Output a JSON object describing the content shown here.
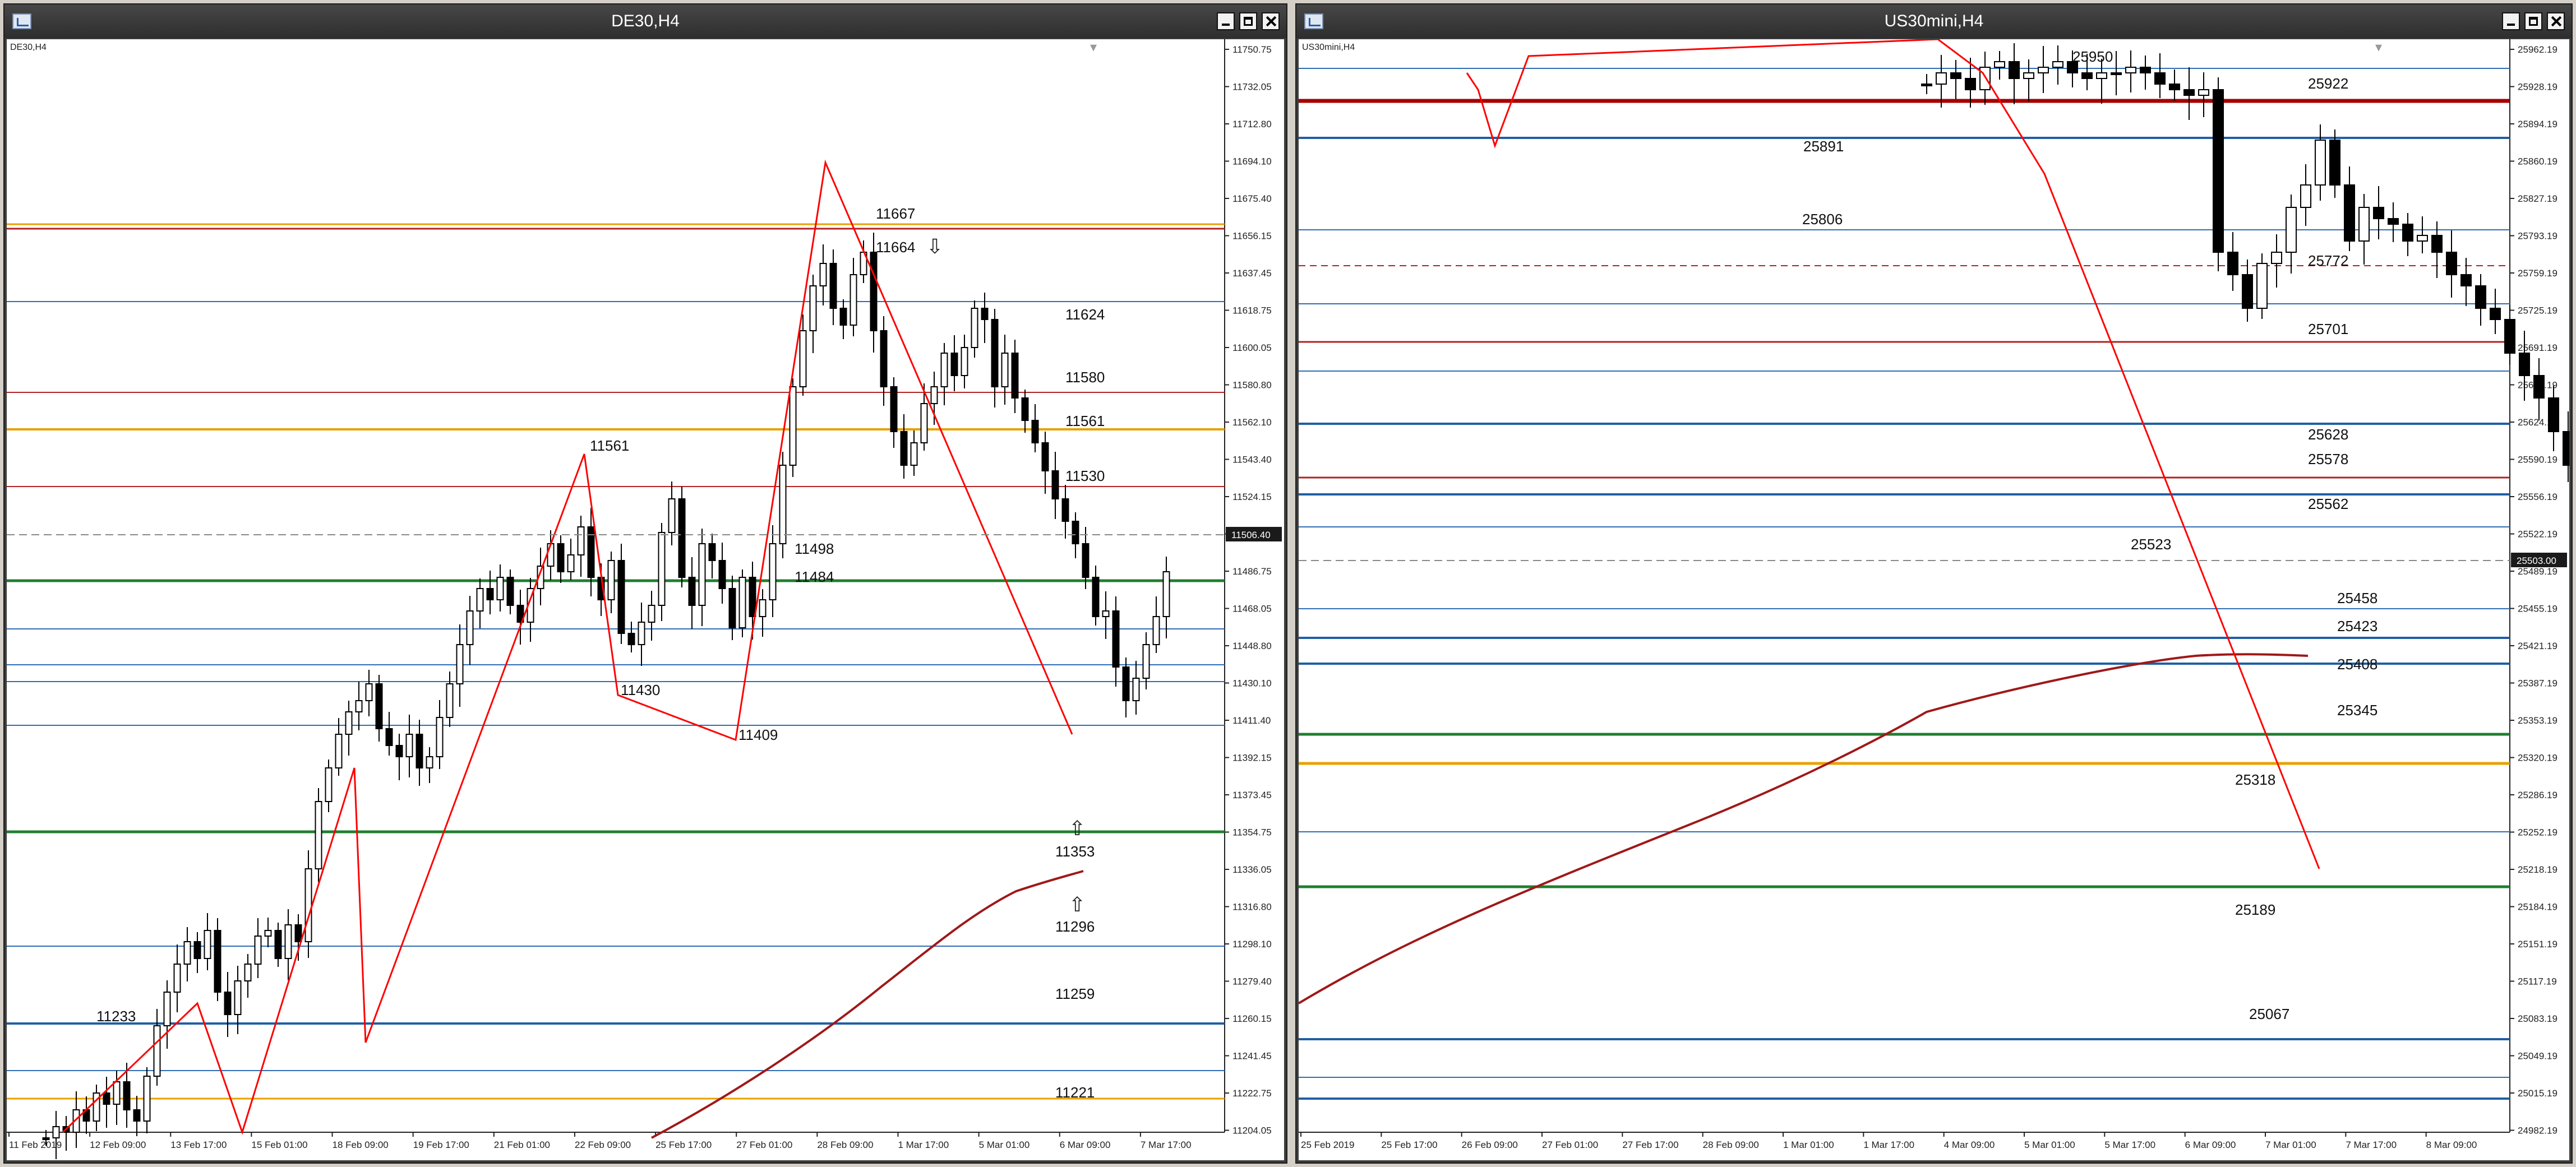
{
  "windows": [
    {
      "id": "left",
      "title": "DE30,H4",
      "symbol_label": "DE30,H4",
      "price_axis": [
        "11750.75",
        "11732.05",
        "11712.80",
        "11694.10",
        "11675.40",
        "11656.15",
        "11637.45",
        "11618.75",
        "11600.05",
        "11580.80",
        "11562.10",
        "11543.40",
        "11524.15",
        "11505.45",
        "11486.75",
        "11468.05",
        "11448.80",
        "11430.10",
        "11411.40",
        "11392.15",
        "11373.45",
        "11354.75",
        "11336.05",
        "11316.80",
        "11298.10",
        "11279.40",
        "11260.15",
        "11241.45",
        "11222.75",
        "11204.05"
      ],
      "current_price": "11506.40",
      "time_axis": [
        "11 Feb 2019",
        "12 Feb 09:00",
        "13 Feb 17:00",
        "15 Feb 01:00",
        "18 Feb 09:00",
        "19 Feb 17:00",
        "21 Feb 01:00",
        "22 Feb 09:00",
        "25 Feb 17:00",
        "27 Feb 01:00",
        "28 Feb 09:00",
        "1 Mar 17:00",
        "5 Mar 01:00",
        "6 Mar 09:00",
        "7 Mar 17:00"
      ],
      "level_labels": [
        "11667",
        "11664",
        "11624",
        "11580",
        "11561",
        "11530",
        "11498",
        "11484",
        "11430",
        "11409",
        "11353",
        "11296",
        "11259",
        "11233",
        "11221",
        "11561"
      ]
    },
    {
      "id": "right",
      "title": "US30mini,H4",
      "symbol_label": "US30mini,H4",
      "price_axis": [
        "25962.19",
        "25928.19",
        "25894.19",
        "25860.19",
        "25827.19",
        "25793.19",
        "25759.19",
        "25725.19",
        "25691.19",
        "25658.19",
        "25624.19",
        "25590.19",
        "25556.19",
        "25522.19",
        "25489.19",
        "25455.19",
        "25421.19",
        "25387.19",
        "25353.19",
        "25320.19",
        "25286.19",
        "25252.19",
        "25218.19",
        "25184.19",
        "25151.19",
        "25117.19",
        "25083.19",
        "25049.19",
        "25015.19",
        "24982.19"
      ],
      "current_price": "25503.00",
      "time_axis": [
        "25 Feb 2019",
        "25 Feb 17:00",
        "26 Feb 09:00",
        "27 Feb 01:00",
        "27 Feb 17:00",
        "28 Feb 09:00",
        "1 Mar 01:00",
        "1 Mar 17:00",
        "4 Mar 09:00",
        "5 Mar 01:00",
        "5 Mar 17:00",
        "6 Mar 09:00",
        "7 Mar 01:00",
        "7 Mar 17:00",
        "8 Mar 09:00"
      ],
      "level_labels": [
        "25950",
        "25922",
        "25891",
        "25806",
        "25772",
        "25701",
        "25628",
        "25578",
        "25562",
        "25523",
        "25458",
        "25423",
        "25408",
        "25345",
        "25318",
        "25189",
        "25067"
      ]
    }
  ],
  "colors": {
    "blue_line": "#2f6db3",
    "thick_blue": "#1f5fa5",
    "red_line": "#b22222",
    "dark_red": "#a50000",
    "orange_line": "#e8a000",
    "green_line": "#1f7f2f",
    "ma_line": "#a01818",
    "zigzag": "#ff0000",
    "current_price_bg": "#1a1a1a"
  }
}
